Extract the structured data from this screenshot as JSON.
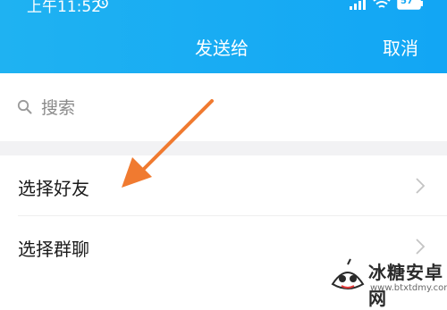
{
  "status_bar": {
    "time": "上午11:52",
    "battery": "57",
    "icons": [
      "alarm-icon",
      "signal-icon",
      "wifi-icon",
      "battery-icon"
    ]
  },
  "header": {
    "title": "发送给",
    "cancel_label": "取消"
  },
  "search": {
    "placeholder": "搜索",
    "icon": "search-icon"
  },
  "list": {
    "items": [
      {
        "label": "选择好友",
        "icon": "chevron-right-icon"
      },
      {
        "label": "选择群聊",
        "icon": "chevron-right-icon"
      }
    ]
  },
  "colors": {
    "header_bg": "#12a6f4",
    "arrow": "#f07a30",
    "divider": "#f2f2f4"
  },
  "watermark": {
    "title": "冰糖安卓网",
    "url": "www.btxtdmy.com"
  }
}
